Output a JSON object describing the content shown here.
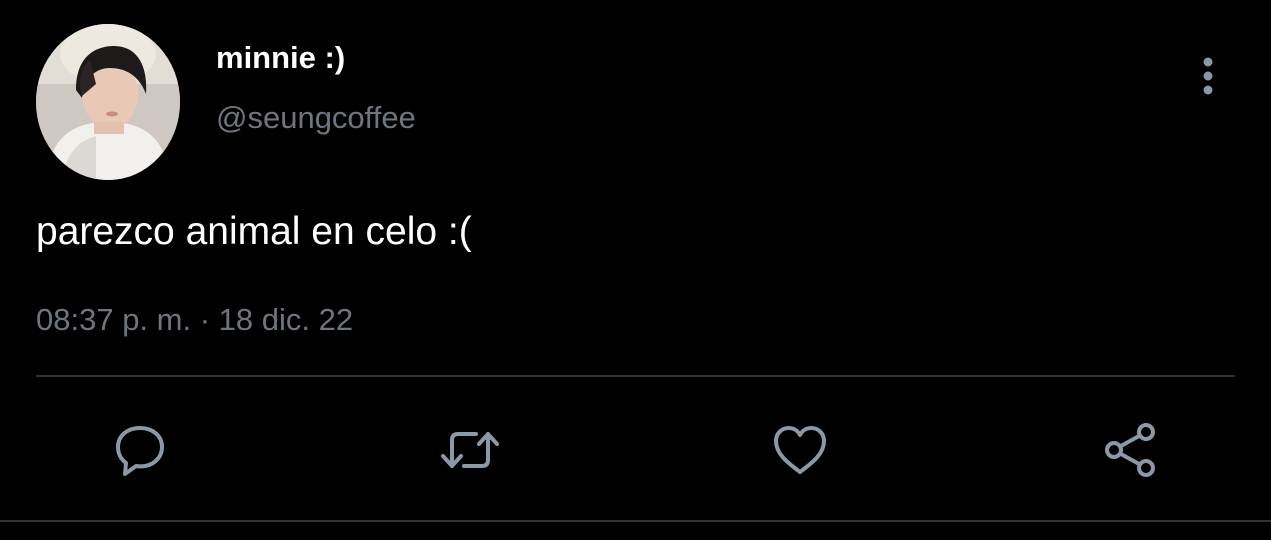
{
  "tweet": {
    "display_name": "minnie :)",
    "handle": "@seungcoffee",
    "text": "parezco animal en celo :(",
    "time": "08:37 p. m.",
    "separator": "·",
    "date": "18 dic. 22"
  },
  "actions": [
    {
      "name": "reply",
      "icon": "speech-bubble-icon"
    },
    {
      "name": "retweet",
      "icon": "retweet-arrows-icon"
    },
    {
      "name": "like",
      "icon": "heart-outline-icon"
    },
    {
      "name": "share",
      "icon": "share-nodes-icon"
    }
  ],
  "colors": {
    "background": "#000000",
    "primary_text": "#ffffff",
    "secondary_text": "#6e767d",
    "icon": "#8b98a5",
    "divider": "#2f3336"
  }
}
